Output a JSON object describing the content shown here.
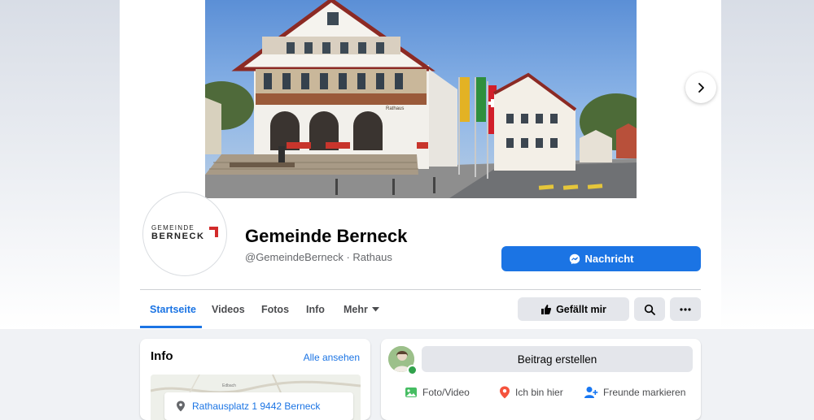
{
  "page": {
    "name": "Gemeinde Berneck",
    "handle_category": "@GemeindeBerneck · Rathaus",
    "logo": {
      "line1": "GEMEINDE",
      "line2": "BERNECK"
    },
    "cover_labels": {
      "rathaus": "Rathaus"
    }
  },
  "actions": {
    "message_label": "Nachricht",
    "like_label": "Gefällt mir"
  },
  "tabs": [
    {
      "label": "Startseite",
      "active": true
    },
    {
      "label": "Videos"
    },
    {
      "label": "Fotos"
    },
    {
      "label": "Info"
    },
    {
      "label": "Mehr"
    }
  ],
  "info": {
    "title": "Info",
    "see_all": "Alle ansehen",
    "address": "Rathausplatz 1 9442 Berneck",
    "map_label": "Edbach"
  },
  "composer": {
    "create_post": "Beitrag erstellen",
    "photo_video": "Foto/Video",
    "check_in": "Ich bin hier",
    "tag_friends": "Freunde markieren"
  },
  "colors": {
    "accent": "#1b74e4",
    "button_gray": "#e4e6eb",
    "online": "#31a24c"
  },
  "icons": [
    "chevron-right-icon",
    "messenger-icon",
    "thumbs-up-icon",
    "search-icon",
    "more-icon",
    "chevron-down-icon",
    "location-pin-icon",
    "photo-icon",
    "tag-friends-icon"
  ]
}
